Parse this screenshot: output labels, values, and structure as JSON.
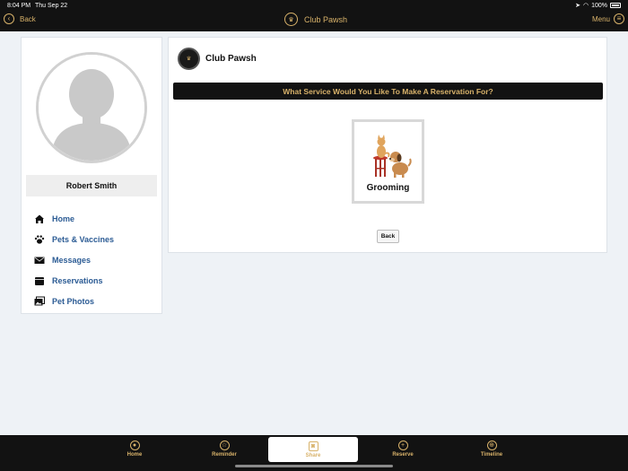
{
  "status_bar": {
    "time": "8:04 PM",
    "date": "Thu Sep 22",
    "battery": "100%"
  },
  "nav": {
    "back_label": "Back",
    "title": "Club Pawsh",
    "menu_label": "Menu"
  },
  "profile": {
    "name": "Robert Smith",
    "menu": [
      {
        "label": "Home",
        "icon": "house-icon"
      },
      {
        "label": "Pets & Vaccines",
        "icon": "paw-icon"
      },
      {
        "label": "Messages",
        "icon": "envelope-icon"
      },
      {
        "label": "Reservations",
        "icon": "calendar-icon"
      },
      {
        "label": "Pet Photos",
        "icon": "photos-icon"
      }
    ]
  },
  "main": {
    "club_name": "Club Pawsh",
    "question": "What Service Would You Like To Make A Reservation For?",
    "services": [
      {
        "label": "Grooming"
      }
    ],
    "back_button": "Back"
  },
  "tabs": [
    {
      "label": "Home",
      "icon": "user-icon"
    },
    {
      "label": "Reminder",
      "icon": "star-icon"
    },
    {
      "label": "Share",
      "icon": "camera-icon",
      "active": true
    },
    {
      "label": "Reserve",
      "icon": "plus-icon"
    },
    {
      "label": "Timeline",
      "icon": "globe-icon"
    }
  ],
  "colors": {
    "accent": "#d8b26a",
    "dark": "#121212",
    "link": "#2b5b94"
  }
}
